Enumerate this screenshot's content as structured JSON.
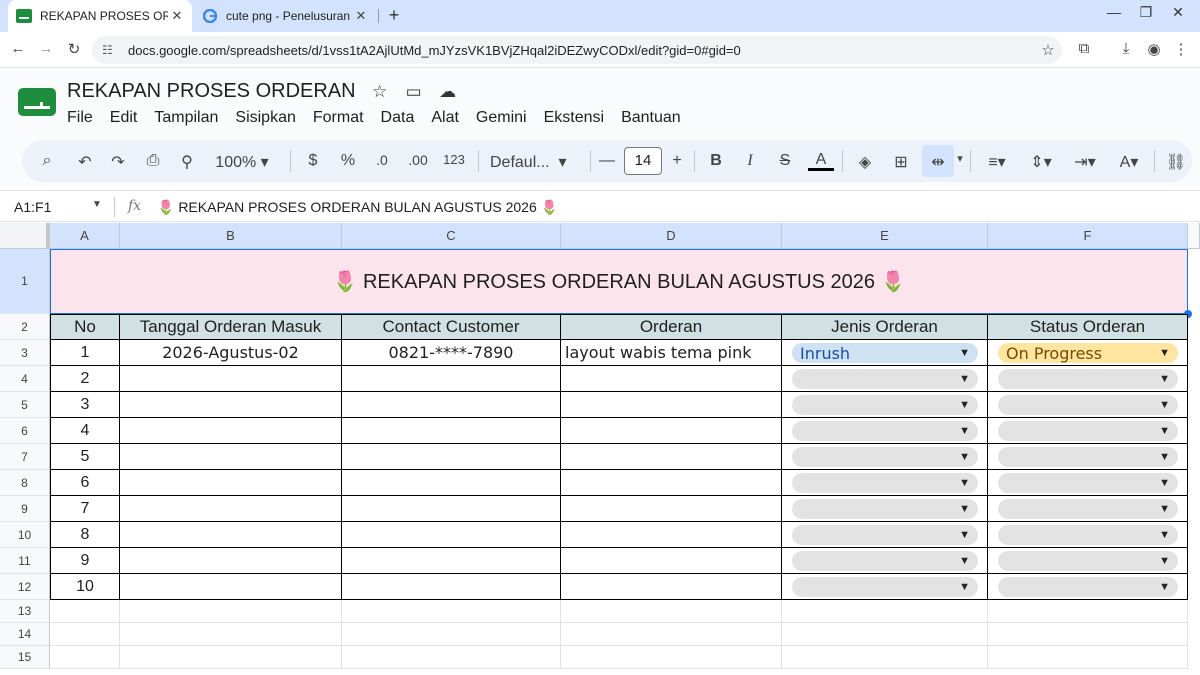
{
  "browser": {
    "tabs": [
      {
        "title": "REKAPAN PROSES ORDERAN - "
      },
      {
        "title": "cute png - Penelusuran Google"
      }
    ],
    "url": "docs.google.com/spreadsheets/d/1vss1tA2AjlUtMd_mJYzsVK1BVjZHqal2iDEZwyCODxl/edit?gid=0#gid=0"
  },
  "doc": {
    "title": "REKAPAN PROSES ORDERAN",
    "menus": [
      "File",
      "Edit",
      "Tampilan",
      "Sisipkan",
      "Format",
      "Data",
      "Alat",
      "Gemini",
      "Ekstensi",
      "Bantuan"
    ]
  },
  "toolbar": {
    "zoom": "100%",
    "currency": "$",
    "percent": "%",
    "dec_decrease": ".0",
    "dec_increase": ".00",
    "number_format": "123",
    "font": "Defaul...",
    "font_size": "14",
    "bold": "B",
    "italic": "I",
    "text_color": "A"
  },
  "formula_bar": {
    "name_box": "A1:F1",
    "fx": "fx",
    "content": "🌷 REKAPAN PROSES ORDERAN BULAN AGUSTUS 2026 🌷"
  },
  "columns": [
    "A",
    "B",
    "C",
    "D",
    "E",
    "F"
  ],
  "row_numbers": [
    "1",
    "2",
    "3",
    "4",
    "5",
    "6",
    "7",
    "8",
    "9",
    "10",
    "11",
    "12",
    "13",
    "14",
    "15"
  ],
  "banner": "🌷 REKAPAN PROSES ORDERAN BULAN AGUSTUS 2026 🌷",
  "headers": [
    "No",
    "Tanggal Orderan Masuk",
    "Contact Customer",
    "Orderan",
    "Jenis Orderan",
    "Status Orderan"
  ],
  "rows": [
    {
      "no": "1",
      "tanggal": "2026-Agustus-02",
      "contact": "0821-****-7890",
      "orderan": "layout wabis tema pink",
      "jenis": "Inrush",
      "status": "On Progress"
    },
    {
      "no": "2",
      "tanggal": "",
      "contact": "",
      "orderan": "",
      "jenis": "",
      "status": ""
    },
    {
      "no": "3",
      "tanggal": "",
      "contact": "",
      "orderan": "",
      "jenis": "",
      "status": ""
    },
    {
      "no": "4",
      "tanggal": "",
      "contact": "",
      "orderan": "",
      "jenis": "",
      "status": ""
    },
    {
      "no": "5",
      "tanggal": "",
      "contact": "",
      "orderan": "",
      "jenis": "",
      "status": ""
    },
    {
      "no": "6",
      "tanggal": "",
      "contact": "",
      "orderan": "",
      "jenis": "",
      "status": ""
    },
    {
      "no": "7",
      "tanggal": "",
      "contact": "",
      "orderan": "",
      "jenis": "",
      "status": ""
    },
    {
      "no": "8",
      "tanggal": "",
      "contact": "",
      "orderan": "",
      "jenis": "",
      "status": ""
    },
    {
      "no": "9",
      "tanggal": "",
      "contact": "",
      "orderan": "",
      "jenis": "",
      "status": ""
    },
    {
      "no": "10",
      "tanggal": "",
      "contact": "",
      "orderan": "",
      "jenis": "",
      "status": ""
    }
  ],
  "colors": {
    "banner_bg": "#fce4ec",
    "header_bg": "#d0e0e3",
    "chip_inrush": "#cfe2f3",
    "chip_progress": "#ffe5a0",
    "chip_empty": "#e3e3e3",
    "selection": "#1a73e8"
  }
}
